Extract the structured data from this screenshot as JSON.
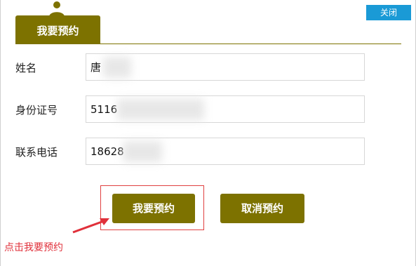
{
  "window": {
    "close_label": "关闭"
  },
  "tab": {
    "label": "我要预约"
  },
  "form": {
    "name": {
      "label": "姓名",
      "value": "唐"
    },
    "id_number": {
      "label": "身份证号",
      "value": "5116"
    },
    "phone": {
      "label": "联系电话",
      "value": "18628"
    }
  },
  "actions": {
    "submit_label": "我要预约",
    "cancel_label": "取消预约"
  },
  "annotation": {
    "text": "点击我要预约"
  },
  "colors": {
    "primary": "#7d7200",
    "close": "#1a9ad6",
    "annotation": "#e0303a"
  }
}
